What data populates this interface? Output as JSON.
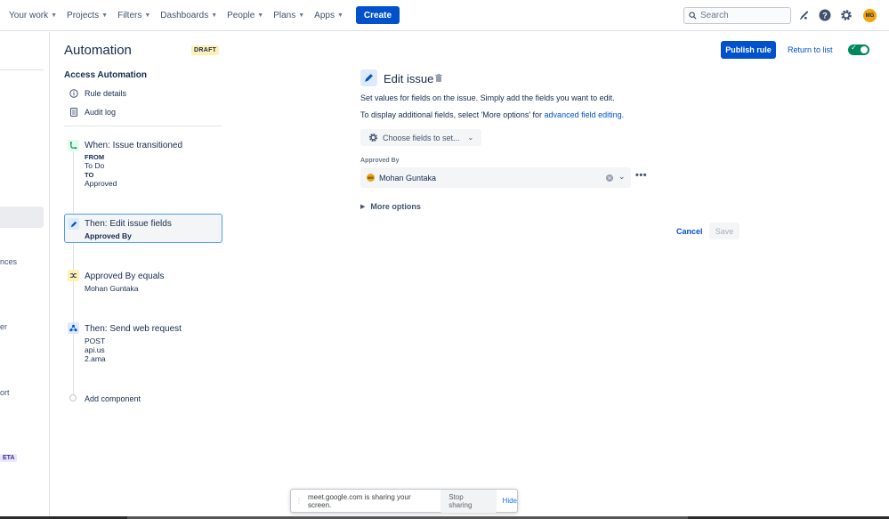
{
  "nav": {
    "items": [
      {
        "label": "Your work"
      },
      {
        "label": "Projects"
      },
      {
        "label": "Filters"
      },
      {
        "label": "Dashboards"
      },
      {
        "label": "People"
      },
      {
        "label": "Plans"
      },
      {
        "label": "Apps"
      }
    ],
    "create_label": "Create",
    "search_placeholder": "Search",
    "avatar_initials": "MG"
  },
  "leftbar": {
    "fragments": [
      "nces",
      "er",
      "ort"
    ],
    "beta_label": "ETA"
  },
  "header": {
    "title": "Automation",
    "badge": "DRAFT",
    "publish_label": "Publish rule",
    "return_label": "Return to list",
    "toggle_on": true
  },
  "rule": {
    "section_title": "Access Automation",
    "menu": [
      {
        "label": "Rule details",
        "icon": "info-icon"
      },
      {
        "label": "Audit log",
        "icon": "document-icon"
      }
    ],
    "trigger": {
      "title": "When: Issue transitioned",
      "from_label": "FROM",
      "from_value": "To Do",
      "to_label": "TO",
      "to_value": "Approved"
    },
    "action_edit": {
      "title": "Then: Edit issue fields",
      "subtitle": "Approved By"
    },
    "condition": {
      "title": "Approved By equals",
      "subtitle": "Mohan Guntaka"
    },
    "web_request": {
      "title": "Then: Send web request",
      "lines": [
        "POST",
        "api.us",
        "2.ama"
      ]
    },
    "add_component_label": "Add component"
  },
  "edit_panel": {
    "title": "Edit issue",
    "desc1": "Set values for fields on the issue. Simply add the fields you want to edit.",
    "desc2_prefix": "To display additional fields, select 'More options' for ",
    "desc2_link": "advanced field editing",
    "desc2_suffix": ".",
    "choose_label": "Choose fields to set...",
    "field_label": "Approved By",
    "field_value": "Mohan Guntaka",
    "field_avatar": "MG",
    "more_options_label": "More options",
    "cancel_label": "Cancel",
    "save_label": "Save"
  },
  "share_bar": {
    "message": "meet.google.com is sharing your screen.",
    "stop_label": "Stop sharing",
    "hide_label": "Hide"
  }
}
